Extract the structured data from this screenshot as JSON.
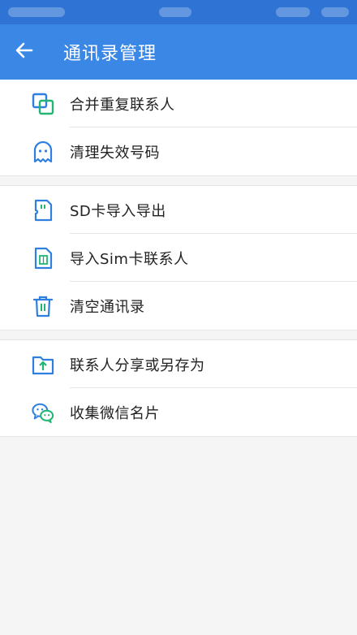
{
  "header": {
    "title": "通讯录管理"
  },
  "groups": [
    {
      "items": [
        {
          "label": "合并重复联系人",
          "icon": "merge-icon"
        },
        {
          "label": "清理失效号码",
          "icon": "ghost-icon"
        }
      ]
    },
    {
      "items": [
        {
          "label": "SD卡导入导出",
          "icon": "sd-card-icon"
        },
        {
          "label": "导入Sim卡联系人",
          "icon": "sim-card-icon"
        },
        {
          "label": "清空通讯录",
          "icon": "trash-icon"
        }
      ]
    },
    {
      "items": [
        {
          "label": "联系人分享或另存为",
          "icon": "folder-upload-icon"
        },
        {
          "label": "收集微信名片",
          "icon": "wechat-icon"
        }
      ]
    }
  ],
  "colors": {
    "appbar": "#3b87e6",
    "statusbar": "#2f74d4",
    "icon_blue": "#2f7fe0",
    "icon_green": "#22b573"
  }
}
